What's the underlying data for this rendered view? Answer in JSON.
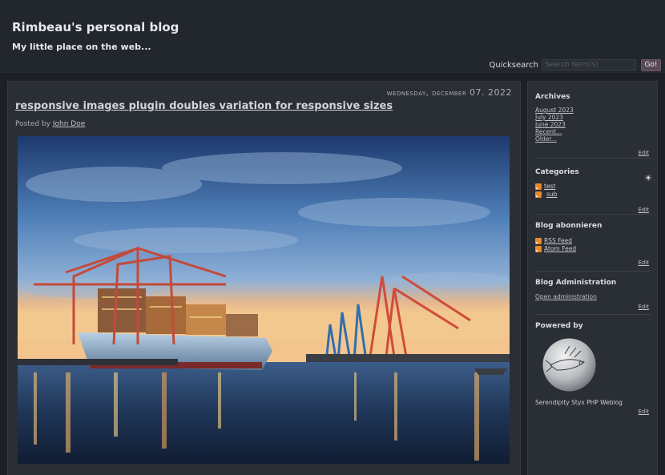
{
  "site": {
    "title": "Rimbeau's personal blog",
    "description": "My little place on the web..."
  },
  "search": {
    "label": "Quicksearch",
    "placeholder": "Search term(s)",
    "button_label": "Go!"
  },
  "entry": {
    "date_prefix": "Wednesday, December",
    "date_day": "07. 2022",
    "title": "responsive images plugin doubles variation for responsive sizes",
    "posted_by_label": "Posted by",
    "author": "John Doe",
    "image_subject": "container-ship-harbor-at-dusk"
  },
  "sidebar": {
    "archives": {
      "title": "Archives",
      "items": [
        "August 2023",
        "July 2023",
        "June 2023",
        "Recent...",
        "Older..."
      ],
      "edit": "Edit"
    },
    "categories": {
      "title": "Categories",
      "items": [
        "test",
        "sub"
      ],
      "edit": "Edit"
    },
    "subscribe": {
      "title": "Blog abonnieren",
      "items": [
        "RSS Feed",
        "Atom Feed"
      ],
      "edit": "Edit"
    },
    "admin": {
      "title": "Blog Administration",
      "link": "Open administration",
      "edit": "Edit"
    },
    "powered": {
      "title": "Powered by",
      "caption": "Serendipity Styx PHP Weblog",
      "edit": "Edit"
    }
  },
  "icons": {
    "theme_toggle": "sun-icon",
    "feed": "rss-icon"
  },
  "colors": {
    "page_bg": "#1d2025",
    "panel_bg": "#2a2e35",
    "header_bg": "#22262d",
    "button_bg": "#5a4a55",
    "rss_orange": "#e8892a"
  }
}
